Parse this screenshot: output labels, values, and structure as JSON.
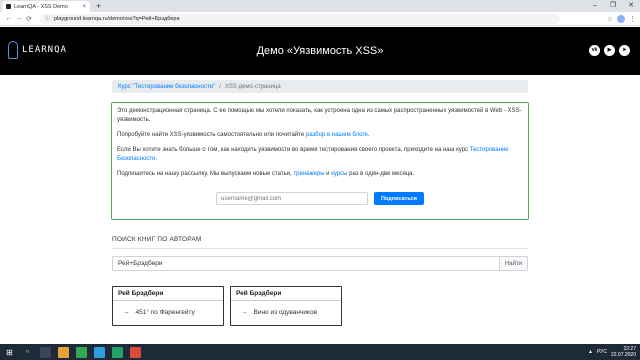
{
  "browser": {
    "tab_title": "LearnQA - XSS Demo",
    "tab_close": "×",
    "new_tab": "+",
    "window_controls": [
      "–",
      "❐",
      "✕"
    ],
    "nav": [
      "←",
      "→",
      "⟳"
    ],
    "url": "playground.learnqa.ru/demo/xss?q=Рей+Брэдбери"
  },
  "header": {
    "logo_text": "LEARNQA",
    "title": "Демо «Уязвимость XSS»",
    "socials": [
      "vk",
      "yt",
      "tg"
    ]
  },
  "breadcrumb": {
    "parent": "Курс \"Тестирование безопасности\"",
    "separator": "/",
    "current": "XSS демо-страница"
  },
  "intro": {
    "p1": "Это демонстрационная страница. С ее помощью мы хотели показать, как устроена одна из самых распространенных уязвимостей в Web - XSS-уязвимость.",
    "p2_before": "Попробуйте найти XSS-уязвимость самостоятельно или почитайте ",
    "p2_link": "разбор в нашем блоге",
    "p2_after": ".",
    "p3_before": "Если Вы хотите знать больше о том, как находить уязвимости во время тестирования своего проекта, приходите на наш курс ",
    "p3_link": "Тестирование Безопасности",
    "p3_after": ".",
    "p4_before": "Подпишитесь на нашу рассылку. Мы выпускаем новые статьи, ",
    "p4_link1": "тренажеры",
    "p4_mid": " и ",
    "p4_link2": "курсы",
    "p4_after": " раз в один-две месяца.",
    "email_placeholder": "username@gmail.com",
    "subscribe_label": "Подписаться"
  },
  "search": {
    "heading": "ПОИСК КНИГ ПО АВТОРАМ",
    "value": "Рей+Брэдбери",
    "button_label": "Найти"
  },
  "results": [
    {
      "author": "Рей Брэдбери",
      "book": "451° по Фаренгейту"
    },
    {
      "author": "Рей Брэдбери",
      "book": "Вино из одуванчиков"
    }
  ],
  "taskbar": {
    "lang": "РУС",
    "time": "22:27",
    "date": "22.07.2020"
  }
}
